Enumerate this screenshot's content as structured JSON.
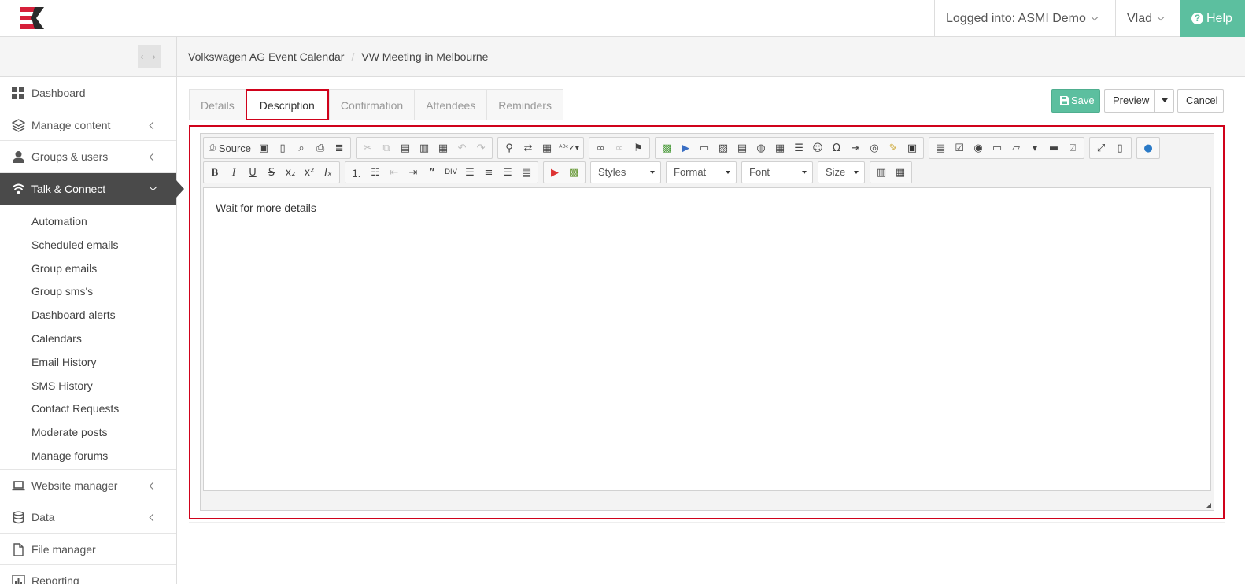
{
  "topbar": {
    "account_label": "Logged into: ASMI Demo",
    "user_label": "Vlad",
    "help_label": "Help"
  },
  "sidebar": {
    "items": [
      {
        "label": "Dashboard",
        "icon": "grid-icon"
      },
      {
        "label": "Manage content",
        "icon": "layers-icon"
      },
      {
        "label": "Groups & users",
        "icon": "user-icon"
      },
      {
        "label": "Talk & Connect",
        "icon": "wifi-icon"
      },
      {
        "label": "Website manager",
        "icon": "laptop-icon"
      },
      {
        "label": "Data",
        "icon": "database-icon"
      },
      {
        "label": "File manager",
        "icon": "file-icon"
      },
      {
        "label": "Reporting",
        "icon": "bar-chart-icon"
      }
    ],
    "sub_items": [
      "Automation",
      "Scheduled emails",
      "Group emails",
      "Group sms's",
      "Dashboard alerts",
      "Calendars",
      "Email History",
      "SMS History",
      "Contact Requests",
      "Moderate posts",
      "Manage forums"
    ]
  },
  "breadcrumb": {
    "parent": "Volkswagen AG Event Calendar",
    "separator": "/",
    "current": "VW Meeting in Melbourne"
  },
  "tabs": [
    "Details",
    "Description",
    "Confirmation",
    "Attendees",
    "Reminders"
  ],
  "actions": {
    "save": "Save",
    "preview": "Preview",
    "cancel": "Cancel"
  },
  "editor": {
    "source_label": "Source",
    "styles": "Styles",
    "format": "Format",
    "font": "Font",
    "size": "Size",
    "content": "Wait for more details"
  },
  "colors": {
    "accent": "#5cbf9f",
    "highlight": "#d0021b",
    "sidebar_active": "#4a4a4a"
  }
}
